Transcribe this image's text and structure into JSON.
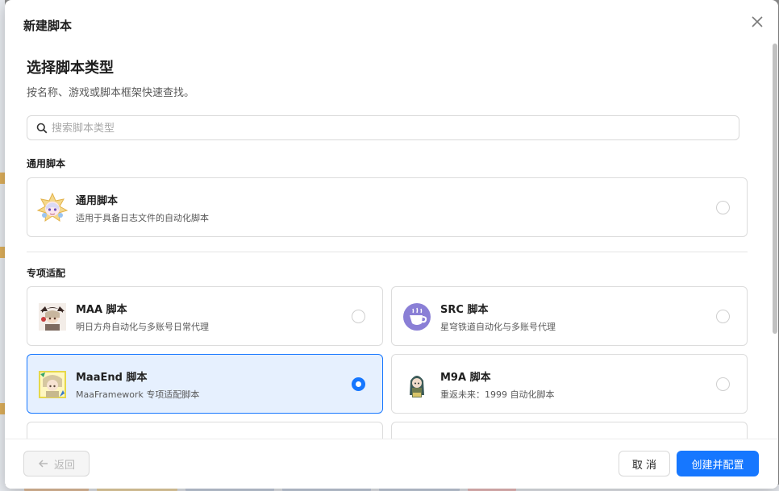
{
  "dialog": {
    "title": "新建脚本",
    "close_icon": "close-icon"
  },
  "content": {
    "heading": "选择脚本类型",
    "subtitle": "按名称、游戏或脚本框架快速查找。",
    "search": {
      "placeholder": "搜索脚本类型",
      "value": "",
      "icon": "search-icon"
    }
  },
  "groups": {
    "general": {
      "label": "通用脚本",
      "items": [
        {
          "name": "通用脚本",
          "desc": "适用于具备日志文件的自动化脚本",
          "selected": false,
          "icon": "general-script-avatar"
        }
      ]
    },
    "special": {
      "label": "专项适配",
      "items": [
        {
          "name": "MAA 脚本",
          "desc": "明日方舟自动化与多账号日常代理",
          "selected": false,
          "icon": "maa-avatar"
        },
        {
          "name": "SRC 脚本",
          "desc": "星穹铁道自动化与多账号代理",
          "selected": false,
          "icon": "src-coffee-avatar"
        },
        {
          "name": "MaaEnd 脚本",
          "desc": "MaaFramework 专项适配脚本",
          "selected": true,
          "icon": "maaend-avatar"
        },
        {
          "name": "M9A 脚本",
          "desc": "重返未来：1999 自动化脚本",
          "selected": false,
          "icon": "m9a-avatar"
        }
      ]
    }
  },
  "footer": {
    "back_label": "返回",
    "cancel_label": "取 消",
    "create_label": "创建并配置"
  },
  "colors": {
    "primary": "#1677ff",
    "selected_bg": "#e6f0fe",
    "border": "#dcdcdc"
  }
}
